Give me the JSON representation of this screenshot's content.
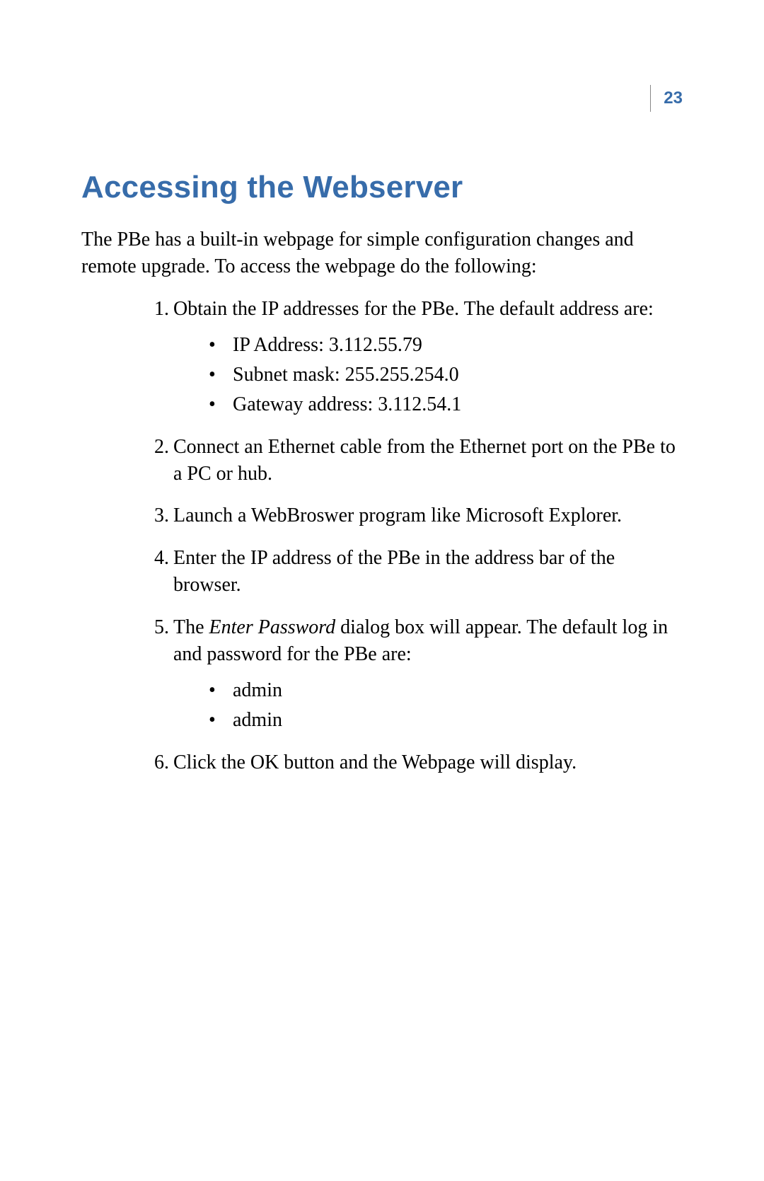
{
  "page_number": "23",
  "title": "Accessing the Webserver",
  "intro": "The PBe has a built-in webpage for simple configuration changes and remote upgrade. To access the webpage do the following:",
  "steps": {
    "s1": {
      "num": "1.",
      "text": "Obtain the IP addresses for the PBe. The default address are:",
      "sub": {
        "a": "IP Address: 3.112.55.79",
        "b": "Subnet mask: 255.255.254.0",
        "c": "Gateway address: 3.112.54.1"
      }
    },
    "s2": {
      "num": "2.",
      "text": "Connect an Ethernet cable from the Ethernet port on the PBe to a PC or hub."
    },
    "s3": {
      "num": "3.",
      "text": "Launch a WebBroswer program like Microsoft Explorer."
    },
    "s4": {
      "num": "4.",
      "text": "Enter the IP address of the PBe in the address bar of the browser."
    },
    "s5": {
      "num": "5.",
      "text_before": "The ",
      "italic": "Enter Password",
      "text_after": " dialog box will appear. The default log in and password for the PBe are:",
      "sub": {
        "a": "admin",
        "b": "admin"
      }
    },
    "s6": {
      "num": "6.",
      "text": "Click the OK button and the Webpage will display."
    }
  }
}
